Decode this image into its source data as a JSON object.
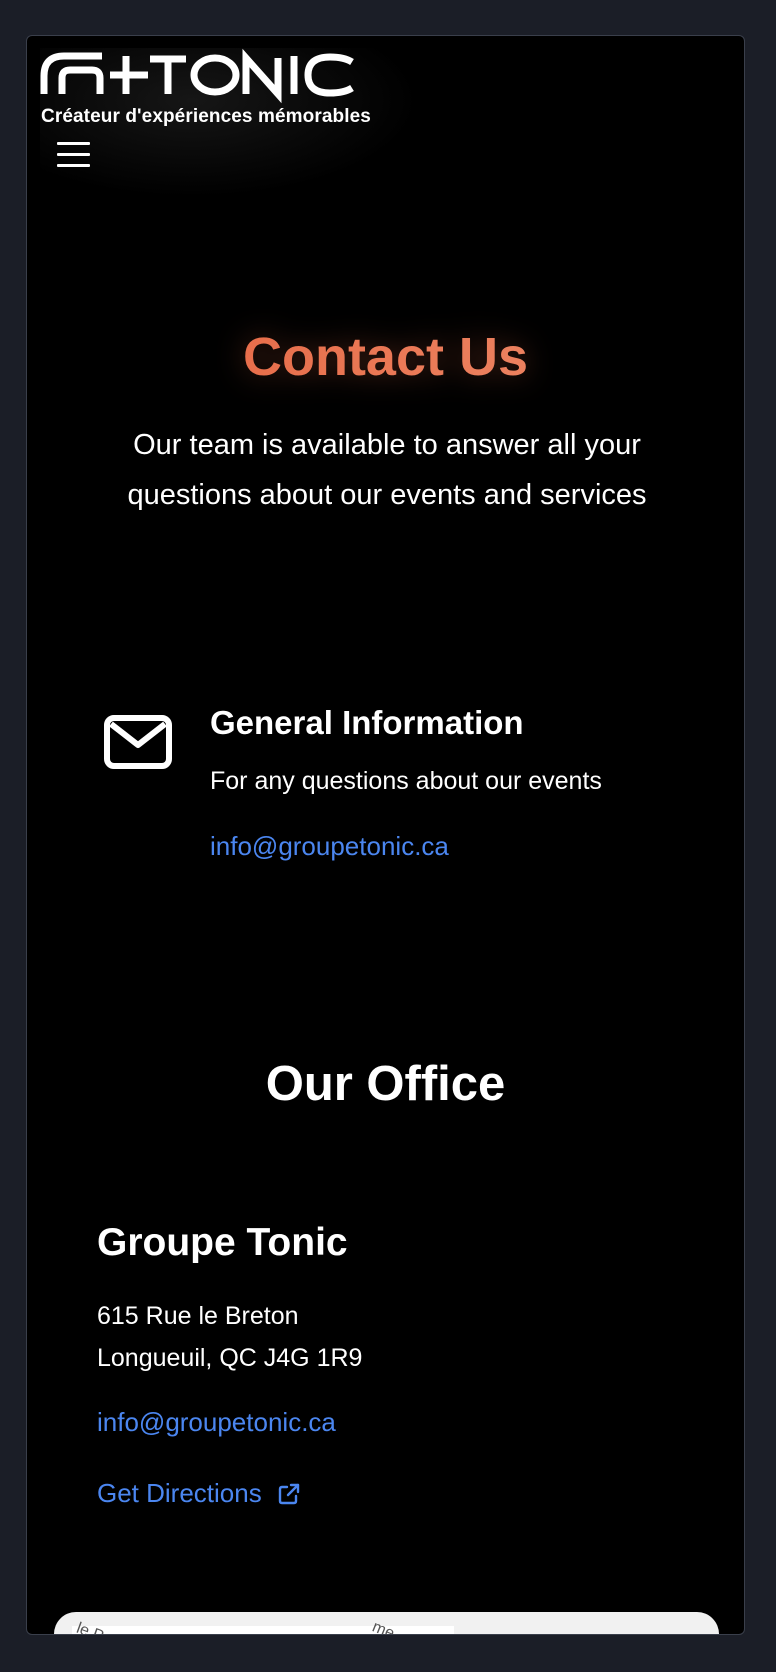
{
  "header": {
    "logo_text": "G+TONIC",
    "tagline": "Créateur d'expériences mémorables",
    "menu_icon": "hamburger-menu-icon"
  },
  "hero": {
    "title": "Contact Us",
    "subtitle": "Our team is available to answer all your questions about our events and services",
    "title_gradient": [
      "#e4603c",
      "#ef8f6e"
    ]
  },
  "general_info": {
    "icon": "envelope-icon",
    "title": "General Information",
    "description": "For any questions about our events",
    "email": "info@groupetonic.ca"
  },
  "office": {
    "heading": "Our Office",
    "name": "Groupe Tonic",
    "address_line1": "615 Rue le Breton",
    "address_line2": "Longueuil, QC J4G 1R9",
    "email": "info@groupetonic.ca",
    "directions_label": "Get Directions",
    "directions_icon": "external-link-icon"
  },
  "map": {
    "label_left": "le P",
    "label_right": "me"
  },
  "colors": {
    "background": "#000000",
    "page_outer": "#1b1e27",
    "link": "#4b86f0",
    "accent": "#e8724f"
  }
}
